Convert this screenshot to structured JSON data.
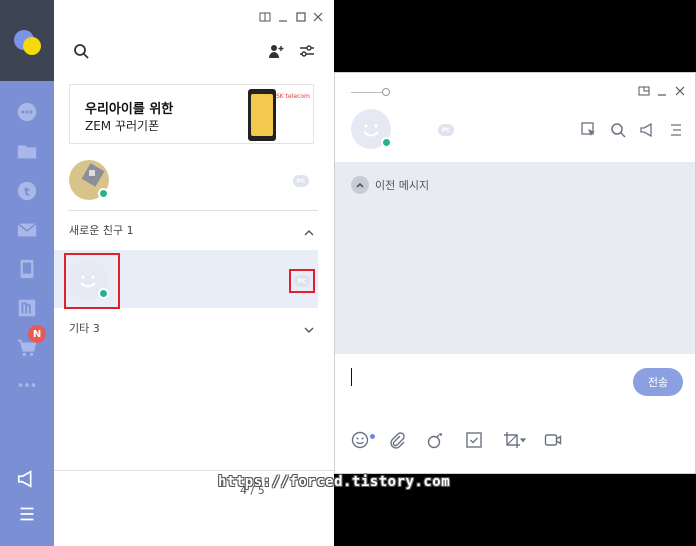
{
  "main_window": {
    "search_label": "",
    "banner": {
      "title": "우리아이를 위한",
      "subtitle": "ZEM 꾸러기폰",
      "brand": "SK telecom"
    },
    "friend_top": {
      "pc_badge": "PC"
    },
    "new_friends_header": "새로운 친구 1",
    "new_friend": {
      "pc_badge": "PC"
    },
    "other_header": "기타 3",
    "pager": "4 / 5"
  },
  "sidebar": {
    "items": [
      {
        "icon": "chat-bubble-icon"
      },
      {
        "icon": "folder-icon"
      },
      {
        "icon": "t-circle-icon"
      },
      {
        "icon": "mail-icon"
      },
      {
        "icon": "tablet-icon"
      },
      {
        "icon": "n-box-icon"
      },
      {
        "icon": "cart-icon",
        "badge": "N"
      },
      {
        "icon": "more-dots-icon"
      }
    ],
    "bottom": [
      {
        "icon": "megaphone-icon"
      },
      {
        "icon": "hamburger-menu-icon"
      }
    ]
  },
  "chat_window": {
    "pc_badge": "PC",
    "previous_messages_label": "이전 메시지",
    "send_label": "전송"
  },
  "watermark": "https://forced.tistory.com",
  "colors": {
    "sidebar_bg": "#7b8fd4",
    "logo_block": "#3d4453",
    "accent": "#8aa0e0",
    "online": "#27b48c",
    "highlight_box": "#e0202a",
    "badge_new": "#e85a55"
  }
}
